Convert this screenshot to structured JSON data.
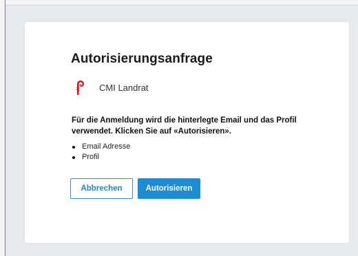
{
  "dialog": {
    "title": "Autorisierungsanfrage",
    "client_name": "CMI Landrat",
    "client_logo_icon": "basel-landschaft-crozier-icon",
    "description": "Für die Anmeldung wird die hinterlegte Email und das Profil verwendet. Klicken Sie auf «Autorisieren».",
    "scopes": [
      {
        "label": "Email Adresse"
      },
      {
        "label": "Profil"
      }
    ],
    "cancel_label": "Abbrechen",
    "authorize_label": "Autorisieren"
  },
  "colors": {
    "page_background": "#e6e9ed",
    "card_background": "#ffffff",
    "accent": "#1c8dd4",
    "logo_red": "#d8161b"
  }
}
